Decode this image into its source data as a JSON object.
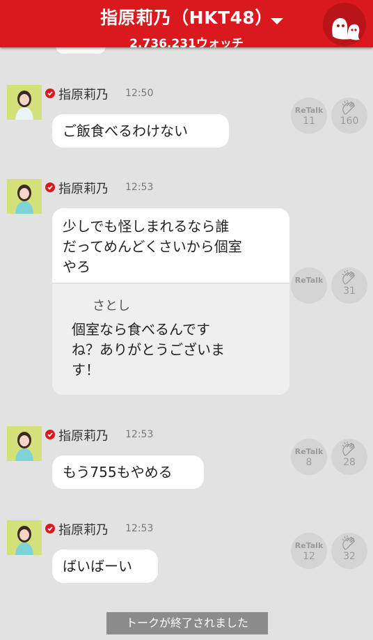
{
  "header": {
    "title": "指原莉乃（HKT48）",
    "watch_count": "2,736,231ウォッチ",
    "logo_icon": "755-logo-icon",
    "dropdown_icon": "caret-down-icon"
  },
  "messages": [
    {
      "name": "指原莉乃",
      "time": "12:50",
      "text": "ご飯食べるわけない",
      "retalk_label": "ReTalk",
      "retalk": "11",
      "claps": "160"
    },
    {
      "name": "指原莉乃",
      "time": "12:53",
      "text": "少しでも怪しまれるなら誰\nだってめんどくさいから個室\nやろ",
      "quote": {
        "name": "さとし",
        "text": "個室なら食べるんです\nね？ありがとうございま\nす！"
      },
      "retalk_label": "ReTalk",
      "retalk": "",
      "claps": "31"
    },
    {
      "name": "指原莉乃",
      "time": "12:53",
      "text": "もう755もやめる",
      "retalk_label": "ReTalk",
      "retalk": "8",
      "claps": "28"
    },
    {
      "name": "指原莉乃",
      "time": "12:53",
      "text": "ばいばーい",
      "retalk_label": "ReTalk",
      "retalk": "12",
      "claps": "32"
    }
  ],
  "footer": {
    "status": "トークが終了されました"
  },
  "colors": {
    "brand_red": "#d9191d",
    "background": "#e2e2e2"
  }
}
